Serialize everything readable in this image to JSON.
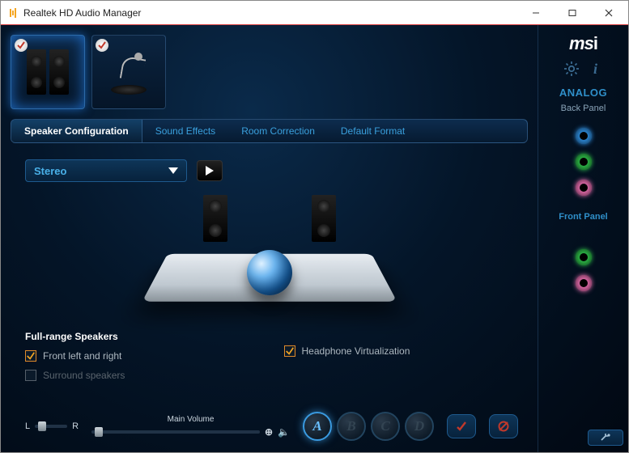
{
  "window": {
    "title": "Realtek HD Audio Manager"
  },
  "brand": "msi",
  "devices": [
    {
      "kind": "speakers",
      "checked": true,
      "selected": true
    },
    {
      "kind": "microphone",
      "checked": true,
      "selected": false
    }
  ],
  "tabs": [
    {
      "label": "Speaker Configuration",
      "active": true
    },
    {
      "label": "Sound Effects",
      "active": false
    },
    {
      "label": "Room Correction",
      "active": false
    },
    {
      "label": "Default Format",
      "active": false
    }
  ],
  "speaker_config": {
    "selected": "Stereo"
  },
  "full_range": {
    "heading": "Full-range Speakers",
    "front": {
      "label": "Front left and right",
      "checked": true
    },
    "surround": {
      "label": "Surround speakers",
      "checked": false,
      "disabled": true
    }
  },
  "headphone_virt": {
    "label": "Headphone Virtualization",
    "checked": true
  },
  "balance": {
    "left_label": "L",
    "right_label": "R",
    "value_pct": 15
  },
  "volume": {
    "label": "Main Volume",
    "value_pct": 2
  },
  "presets": [
    {
      "letter": "A",
      "active": true
    },
    {
      "letter": "B",
      "active": false
    },
    {
      "letter": "C",
      "active": false
    },
    {
      "letter": "D",
      "active": false
    }
  ],
  "side": {
    "analog_label": "ANALOG",
    "back_panel_label": "Back Panel",
    "front_panel_label": "Front Panel",
    "back_jacks": [
      {
        "color": "#2f8fe0"
      },
      {
        "color": "#2fbf4a"
      },
      {
        "color": "#e86fb0"
      }
    ],
    "front_jacks": [
      {
        "color": "#2fbf4a"
      },
      {
        "color": "#e86fb0"
      }
    ]
  }
}
